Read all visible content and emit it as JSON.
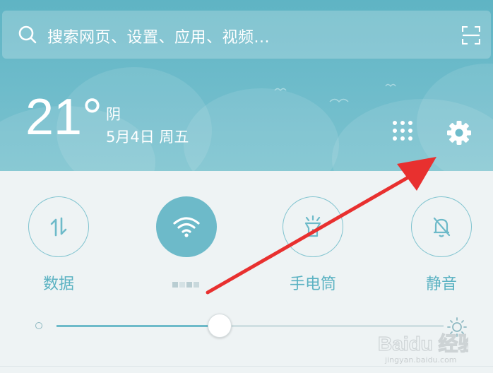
{
  "search": {
    "placeholder": "搜索网页、设置、应用、视频..."
  },
  "weather": {
    "temperature": "21°",
    "condition": "阴",
    "date": "5月4日 周五"
  },
  "tiles": [
    {
      "label": "数据",
      "icon": "data-transfer-icon",
      "active": false
    },
    {
      "label": "",
      "icon": "wifi-icon",
      "active": true
    },
    {
      "label": "手电筒",
      "icon": "flashlight-icon",
      "active": false
    },
    {
      "label": "静音",
      "icon": "mute-bell-icon",
      "active": false
    }
  ],
  "brightness": {
    "level": 0.42
  },
  "watermark": {
    "brand": "Baidu 经验",
    "url": "jingyan.baidu.com"
  },
  "colors": {
    "accent": "#6dbac9",
    "header": "#6fbccb",
    "arrow": "#e8302f"
  }
}
